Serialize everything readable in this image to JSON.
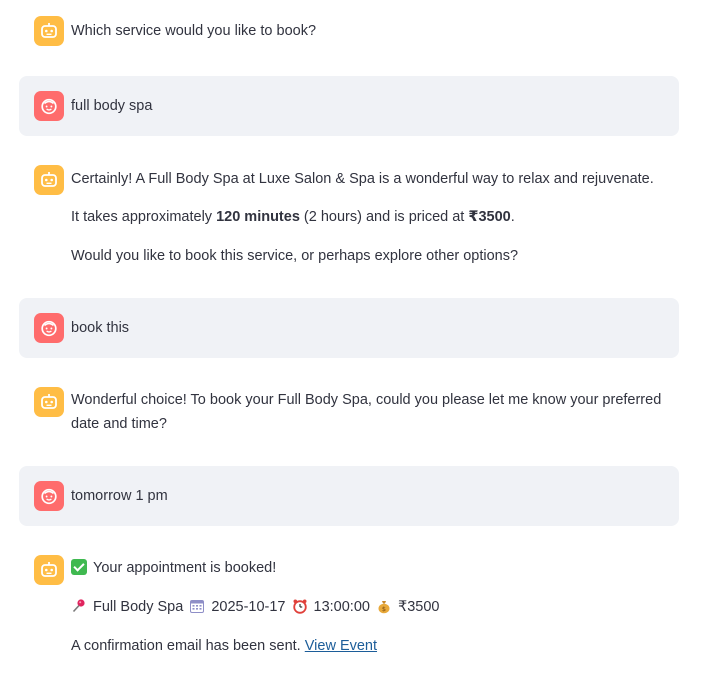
{
  "messages": [
    {
      "role": "assistant",
      "text": "Which service would you like to book?"
    },
    {
      "role": "user",
      "text": "full body spa"
    },
    {
      "role": "assistant",
      "para1": "Certainly! A Full Body Spa at Luxe Salon & Spa is a wonderful way to relax and rejuvenate.",
      "para2_pre": "It takes approximately ",
      "para2_bold1": "120 minutes",
      "para2_mid": " (2 hours) and is priced at ",
      "para2_bold2": "₹3500",
      "para2_post": ".",
      "para3": "Would you like to book this service, or perhaps explore other options?"
    },
    {
      "role": "user",
      "text": "book this"
    },
    {
      "role": "assistant",
      "text": "Wonderful choice! To book your Full Body Spa, could you please let me know your preferred date and time?"
    },
    {
      "role": "user",
      "text": "tomorrow 1 pm"
    },
    {
      "role": "assistant",
      "booked": "Your appointment is booked!",
      "service": "Full Body Spa",
      "date": "2025-10-17",
      "time": "13:00:00",
      "price": "₹3500",
      "email_text": "A confirmation email has been sent.",
      "link_label": "View Event"
    }
  ],
  "icons": {
    "assistant_avatar": "robot-face-icon",
    "user_avatar": "smiling-face-icon",
    "check": "check-mark-icon",
    "pin": "pushpin-icon",
    "calendar": "calendar-icon",
    "clock": "alarm-clock-icon",
    "money": "money-bag-icon"
  },
  "colors": {
    "assistant_avatar_bg": "#ffbd45",
    "user_avatar_bg": "#ff6c6c",
    "user_bubble_bg": "#f0f2f6",
    "link": "#1c5d99",
    "text": "#31333f"
  }
}
